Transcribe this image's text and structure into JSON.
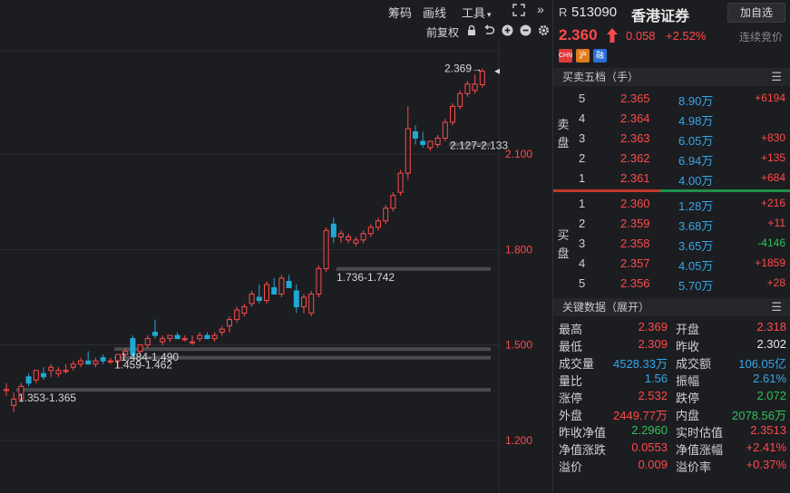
{
  "toolbar": {
    "chips": "筹码",
    "lines": "画线",
    "tools": "工具",
    "expand_icon": "expand-icon",
    "collapse_icon": "double-chevron-right-icon"
  },
  "subbar": {
    "adjust_label": "前复权",
    "icons": [
      "lock-icon",
      "undo-icon",
      "zoom-in-icon",
      "zoom-out-icon",
      "gear-icon"
    ]
  },
  "chart": {
    "price_axis": [
      "2.100",
      "1.800",
      "1.500",
      "1.200"
    ],
    "annotations": [
      {
        "text": "2.369→"
      },
      {
        "text": "2.127-2.133"
      },
      {
        "text": "1.736-1.742"
      },
      {
        "text": "1.484-1.490"
      },
      {
        "text": "1.459-1.462"
      },
      {
        "text": "1.353-1.365"
      }
    ]
  },
  "chart_data": {
    "type": "candlestick",
    "ylim": [
      1.09,
      2.4
    ],
    "price_ticks": [
      2.1,
      1.8,
      1.5,
      1.2
    ],
    "support_bands": [
      {
        "range": "2.127-2.133",
        "value": 2.13
      },
      {
        "range": "1.736-1.742",
        "value": 1.739
      },
      {
        "range": "1.484-1.490",
        "value": 1.487
      },
      {
        "range": "1.459-1.462",
        "value": 1.46
      },
      {
        "range": "1.353-1.365",
        "value": 1.359
      }
    ],
    "latest_high": 2.369,
    "candles": [
      [
        1.36,
        1.38,
        1.34,
        1.36
      ],
      [
        1.31,
        1.35,
        1.29,
        1.33
      ],
      [
        1.33,
        1.38,
        1.32,
        1.37
      ],
      [
        1.4,
        1.41,
        1.37,
        1.38
      ],
      [
        1.39,
        1.42,
        1.38,
        1.42
      ],
      [
        1.41,
        1.43,
        1.39,
        1.4
      ],
      [
        1.42,
        1.44,
        1.4,
        1.43
      ],
      [
        1.41,
        1.43,
        1.4,
        1.42
      ],
      [
        1.42,
        1.44,
        1.41,
        1.42
      ],
      [
        1.43,
        1.45,
        1.42,
        1.44
      ],
      [
        1.44,
        1.46,
        1.43,
        1.45
      ],
      [
        1.45,
        1.48,
        1.44,
        1.44
      ],
      [
        1.44,
        1.46,
        1.43,
        1.45
      ],
      [
        1.46,
        1.47,
        1.44,
        1.45
      ],
      [
        1.45,
        1.46,
        1.44,
        1.45
      ],
      [
        1.45,
        1.47,
        1.43,
        1.47
      ],
      [
        1.47,
        1.49,
        1.46,
        1.48
      ],
      [
        1.52,
        1.53,
        1.46,
        1.47
      ],
      [
        1.48,
        1.5,
        1.47,
        1.5
      ],
      [
        1.5,
        1.53,
        1.49,
        1.52
      ],
      [
        1.54,
        1.58,
        1.52,
        1.53
      ],
      [
        1.51,
        1.53,
        1.5,
        1.52
      ],
      [
        1.52,
        1.53,
        1.51,
        1.53
      ],
      [
        1.53,
        1.54,
        1.52,
        1.52
      ],
      [
        1.52,
        1.53,
        1.51,
        1.52
      ],
      [
        1.51,
        1.53,
        1.5,
        1.51
      ],
      [
        1.52,
        1.54,
        1.51,
        1.53
      ],
      [
        1.53,
        1.54,
        1.52,
        1.52
      ],
      [
        1.52,
        1.54,
        1.51,
        1.53
      ],
      [
        1.54,
        1.56,
        1.53,
        1.55
      ],
      [
        1.56,
        1.59,
        1.54,
        1.58
      ],
      [
        1.58,
        1.62,
        1.57,
        1.61
      ],
      [
        1.6,
        1.63,
        1.59,
        1.62
      ],
      [
        1.63,
        1.67,
        1.62,
        1.66
      ],
      [
        1.65,
        1.69,
        1.63,
        1.64
      ],
      [
        1.64,
        1.7,
        1.63,
        1.69
      ],
      [
        1.68,
        1.71,
        1.66,
        1.66
      ],
      [
        1.66,
        1.72,
        1.65,
        1.71
      ],
      [
        1.7,
        1.72,
        1.68,
        1.68
      ],
      [
        1.67,
        1.69,
        1.6,
        1.62
      ],
      [
        1.62,
        1.66,
        1.6,
        1.65
      ],
      [
        1.6,
        1.67,
        1.59,
        1.66
      ],
      [
        1.66,
        1.75,
        1.65,
        1.74
      ],
      [
        1.74,
        1.87,
        1.73,
        1.86
      ],
      [
        1.88,
        1.9,
        1.82,
        1.84
      ],
      [
        1.84,
        1.86,
        1.82,
        1.85
      ],
      [
        1.83,
        1.85,
        1.82,
        1.84
      ],
      [
        1.82,
        1.84,
        1.81,
        1.83
      ],
      [
        1.83,
        1.86,
        1.82,
        1.85
      ],
      [
        1.85,
        1.88,
        1.84,
        1.87
      ],
      [
        1.87,
        1.9,
        1.86,
        1.89
      ],
      [
        1.89,
        1.94,
        1.88,
        1.93
      ],
      [
        1.93,
        1.98,
        1.92,
        1.97
      ],
      [
        1.98,
        2.05,
        1.97,
        2.04
      ],
      [
        2.04,
        2.25,
        2.02,
        2.18
      ],
      [
        2.17,
        2.19,
        2.13,
        2.15
      ],
      [
        2.14,
        2.17,
        2.12,
        2.13
      ],
      [
        2.12,
        2.14,
        2.11,
        2.14
      ],
      [
        2.13,
        2.16,
        2.12,
        2.15
      ],
      [
        2.15,
        2.21,
        2.14,
        2.2
      ],
      [
        2.2,
        2.26,
        2.19,
        2.25
      ],
      [
        2.25,
        2.3,
        2.24,
        2.29
      ],
      [
        2.29,
        2.33,
        2.28,
        2.32
      ],
      [
        2.3,
        2.35,
        2.29,
        2.32
      ],
      [
        2.318,
        2.369,
        2.309,
        2.36
      ]
    ]
  },
  "stock": {
    "badge": "R",
    "code": "513090",
    "name": "香港证券",
    "add_label": "加自选",
    "price": "2.360",
    "change": "0.058",
    "change_pct": "+2.52%",
    "trade_status": "连续竞价",
    "tags": [
      "CHN",
      "沪",
      "融"
    ],
    "tag_colors": [
      "#e03b3b",
      "#e07a1f",
      "#2a6fd6"
    ]
  },
  "orderbook": {
    "title": "买卖五档（手）",
    "sell_label": "卖盘",
    "buy_label": "买盘",
    "sell": [
      {
        "level": "5",
        "price": "2.365",
        "volume": "8.90万",
        "delta": "+6194"
      },
      {
        "level": "4",
        "price": "2.364",
        "volume": "4.98万",
        "delta": ""
      },
      {
        "level": "3",
        "price": "2.363",
        "volume": "6.05万",
        "delta": "+830"
      },
      {
        "level": "2",
        "price": "2.362",
        "volume": "6.94万",
        "delta": "+135"
      },
      {
        "level": "1",
        "price": "2.361",
        "volume": "4.00万",
        "delta": "+684"
      }
    ],
    "buy": [
      {
        "level": "1",
        "price": "2.360",
        "volume": "1.28万",
        "delta": "+216"
      },
      {
        "level": "2",
        "price": "2.359",
        "volume": "3.68万",
        "delta": "+11"
      },
      {
        "level": "3",
        "price": "2.358",
        "volume": "3.65万",
        "delta": "-4146"
      },
      {
        "level": "4",
        "price": "2.357",
        "volume": "4.05万",
        "delta": "+1859"
      },
      {
        "level": "5",
        "price": "2.356",
        "volume": "5.70万",
        "delta": "+28"
      }
    ],
    "buy_ratio": 0.55
  },
  "keydata": {
    "title": "关键数据（展开）",
    "rows": [
      {
        "l1": "最高",
        "v1": "2.369",
        "c1": "red",
        "l2": "开盘",
        "v2": "2.318",
        "c2": "red"
      },
      {
        "l1": "最低",
        "v1": "2.309",
        "c1": "red",
        "l2": "昨收",
        "v2": "2.302",
        "c2": "white"
      },
      {
        "l1": "成交量",
        "v1": "4528.33万",
        "c1": "blue",
        "l2": "成交额",
        "v2": "106.05亿",
        "c2": "blue"
      },
      {
        "l1": "量比",
        "v1": "1.56",
        "c1": "blue",
        "l2": "振幅",
        "v2": "2.61%",
        "c2": "blue"
      },
      {
        "l1": "涨停",
        "v1": "2.532",
        "c1": "red",
        "l2": "跌停",
        "v2": "2.072",
        "c2": "green"
      },
      {
        "l1": "外盘",
        "v1": "2449.77万",
        "c1": "red",
        "l2": "内盘",
        "v2": "2078.56万",
        "c2": "green"
      },
      {
        "l1": "昨收净值",
        "v1": "2.2960",
        "c1": "green",
        "l2": "实时估值",
        "v2": "2.3513",
        "c2": "red"
      },
      {
        "l1": "净值涨跌",
        "v1": "0.0553",
        "c1": "red",
        "l2": "净值涨幅",
        "v2": "+2.41%",
        "c2": "red"
      },
      {
        "l1": "溢价",
        "v1": "0.009",
        "c1": "red",
        "l2": "溢价率",
        "v2": "+0.37%",
        "c2": "red"
      }
    ]
  },
  "colors": {
    "up": "#ff4a4a",
    "down": "#2fc25b",
    "blue": "#34a7e8",
    "bg": "#1c1d21",
    "grid": "#2e2f34"
  }
}
